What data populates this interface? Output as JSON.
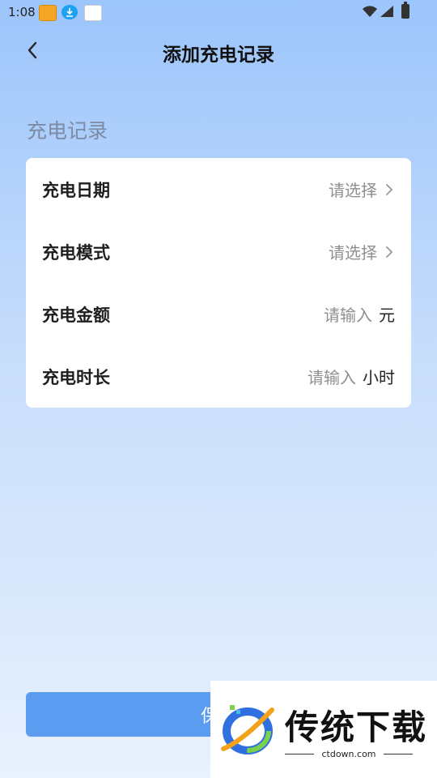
{
  "status_bar": {
    "time": "1:08"
  },
  "header": {
    "title": "添加充电记录"
  },
  "section": {
    "title": "充电记录"
  },
  "form": {
    "rows": [
      {
        "label": "充电日期",
        "placeholder": "请选择",
        "unit": ""
      },
      {
        "label": "充电模式",
        "placeholder": "请选择",
        "unit": ""
      },
      {
        "label": "充电金额",
        "placeholder": "请输入",
        "unit": "元"
      },
      {
        "label": "充电时长",
        "placeholder": "请输入",
        "unit": "小时"
      }
    ]
  },
  "actions": {
    "save_label": "保存"
  },
  "watermark": {
    "brand": "传统下载",
    "domain": "ctdown.com"
  },
  "colors": {
    "accent": "#5b9cf0",
    "section_text": "#7c8ba3",
    "placeholder": "#8f8f8f"
  }
}
